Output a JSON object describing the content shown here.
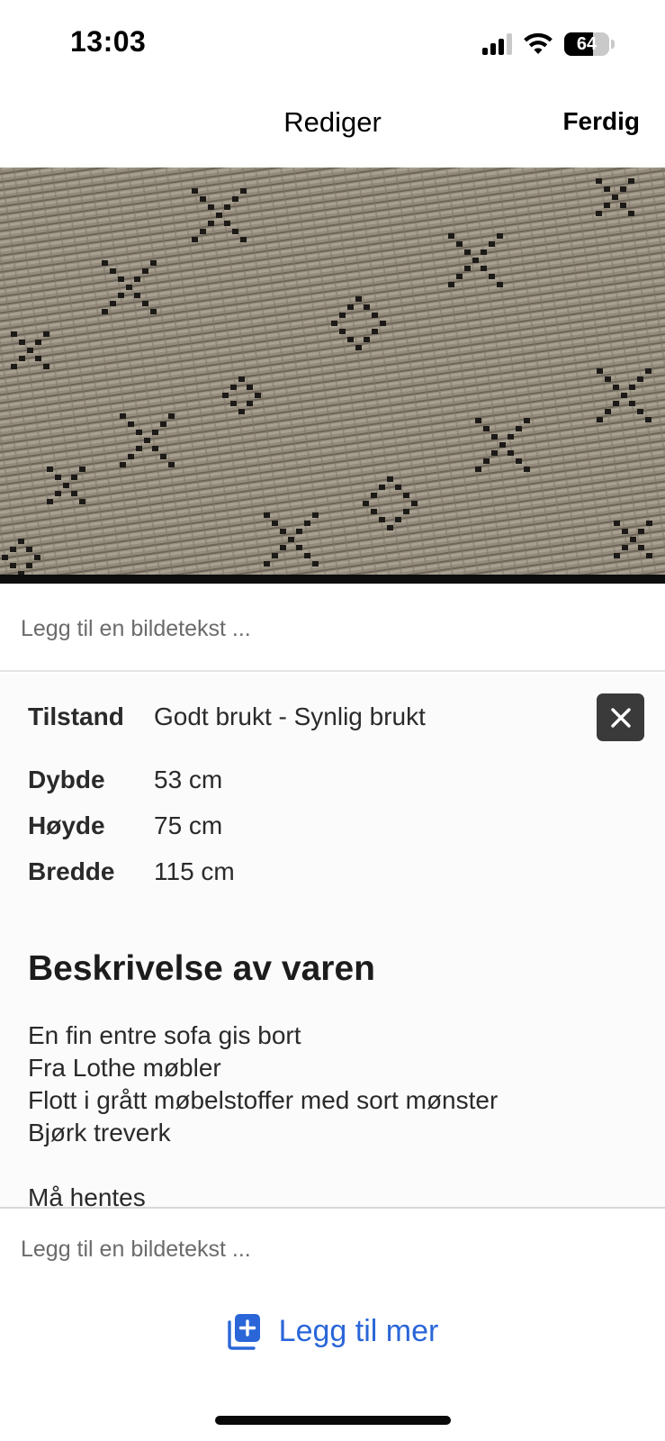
{
  "status_bar": {
    "time": "13:03",
    "battery_level": "64",
    "battery_fraction": 0.64,
    "signal_bars_active": 3,
    "signal_bars_total": 4
  },
  "nav": {
    "title": "Rediger",
    "done_label": "Ferdig"
  },
  "photo": {
    "subject_icon": "fabric-photo",
    "fabric_color": "#8a8274",
    "pattern_color": "#1c1a16"
  },
  "caption_1": {
    "placeholder": "Legg til en bildetekst ..."
  },
  "screenshot_card": {
    "remove_icon": "close-icon",
    "specs": [
      {
        "key": "Tilstand",
        "value": "Godt brukt - Synlig brukt"
      },
      {
        "key": "Dybde",
        "value": "53 cm"
      },
      {
        "key": "Høyde",
        "value": "75 cm"
      },
      {
        "key": "Bredde",
        "value": "115 cm"
      }
    ],
    "description_heading": "Beskrivelse av varen",
    "description_lines": [
      "En fin entre sofa gis bort",
      "Fra Lothe møbler",
      "Flott i grått møbelstoffer med sort mønster",
      "Bjørk treverk"
    ],
    "description_cutoff": "Må hentes"
  },
  "caption_2": {
    "placeholder": "Legg til en bildetekst ..."
  },
  "add_more": {
    "label": "Legg til mer",
    "icon": "add-media-icon",
    "accent_color": "#2a66d8"
  }
}
